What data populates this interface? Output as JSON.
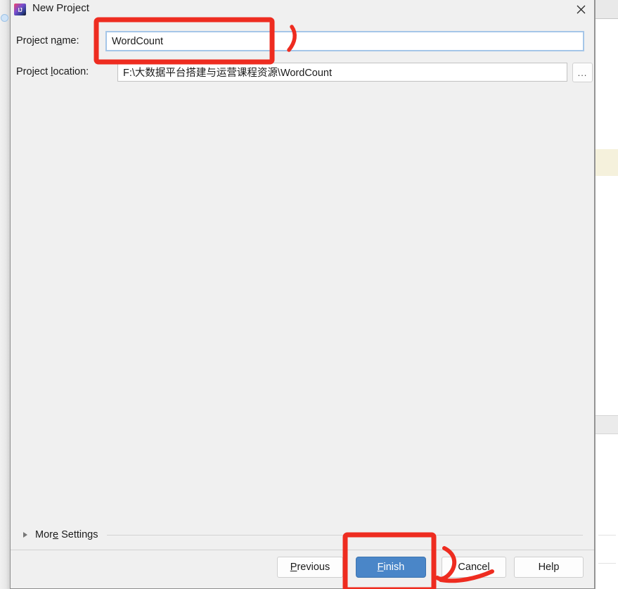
{
  "window": {
    "title": "New Project",
    "icon": "intellij-idea-icon",
    "icon_text": "IJ",
    "close_label": "✕"
  },
  "form": {
    "project_name": {
      "label_prefix": "Project n",
      "label_mnemonic": "a",
      "label_suffix": "me:",
      "value": "WordCount",
      "placeholder": ""
    },
    "project_location": {
      "label_prefix": "Project ",
      "label_mnemonic": "l",
      "label_suffix": "ocation:",
      "value": "F:\\大数据平台搭建与运营课程资源\\WordCount",
      "placeholder": "",
      "browse_label": "..."
    }
  },
  "more_settings": {
    "label_prefix": "Mor",
    "label_mnemonic": "e",
    "label_suffix": " Settings",
    "expanded": false,
    "chevron_icon": "chevron-right-icon"
  },
  "footer": {
    "buttons": [
      {
        "name": "previous",
        "prefix": "",
        "mnemonic": "P",
        "suffix": "revious",
        "primary": false
      },
      {
        "name": "finish",
        "prefix": "",
        "mnemonic": "F",
        "suffix": "inish",
        "primary": true
      },
      {
        "name": "cancel",
        "prefix": "",
        "mnemonic": "",
        "suffix": "Cancel",
        "primary": false
      },
      {
        "name": "help",
        "prefix": "",
        "mnemonic": "",
        "suffix": "Help",
        "primary": false
      }
    ]
  },
  "annotations": {
    "color": "#ee2c20",
    "items": [
      {
        "name": "name-field-highlight-box",
        "shape": "rect"
      },
      {
        "name": "name-field-pointer-stroke",
        "shape": "stroke"
      },
      {
        "name": "finish-button-highlight-box",
        "shape": "rect"
      },
      {
        "name": "cancel-button-pointer-arrow",
        "shape": "arrow"
      }
    ]
  },
  "colors": {
    "accent": "#4a86c8",
    "dialog_bg": "#f0f0f0",
    "annotation_red": "#ee2c20",
    "input_focus_border": "#a5c6e8"
  }
}
